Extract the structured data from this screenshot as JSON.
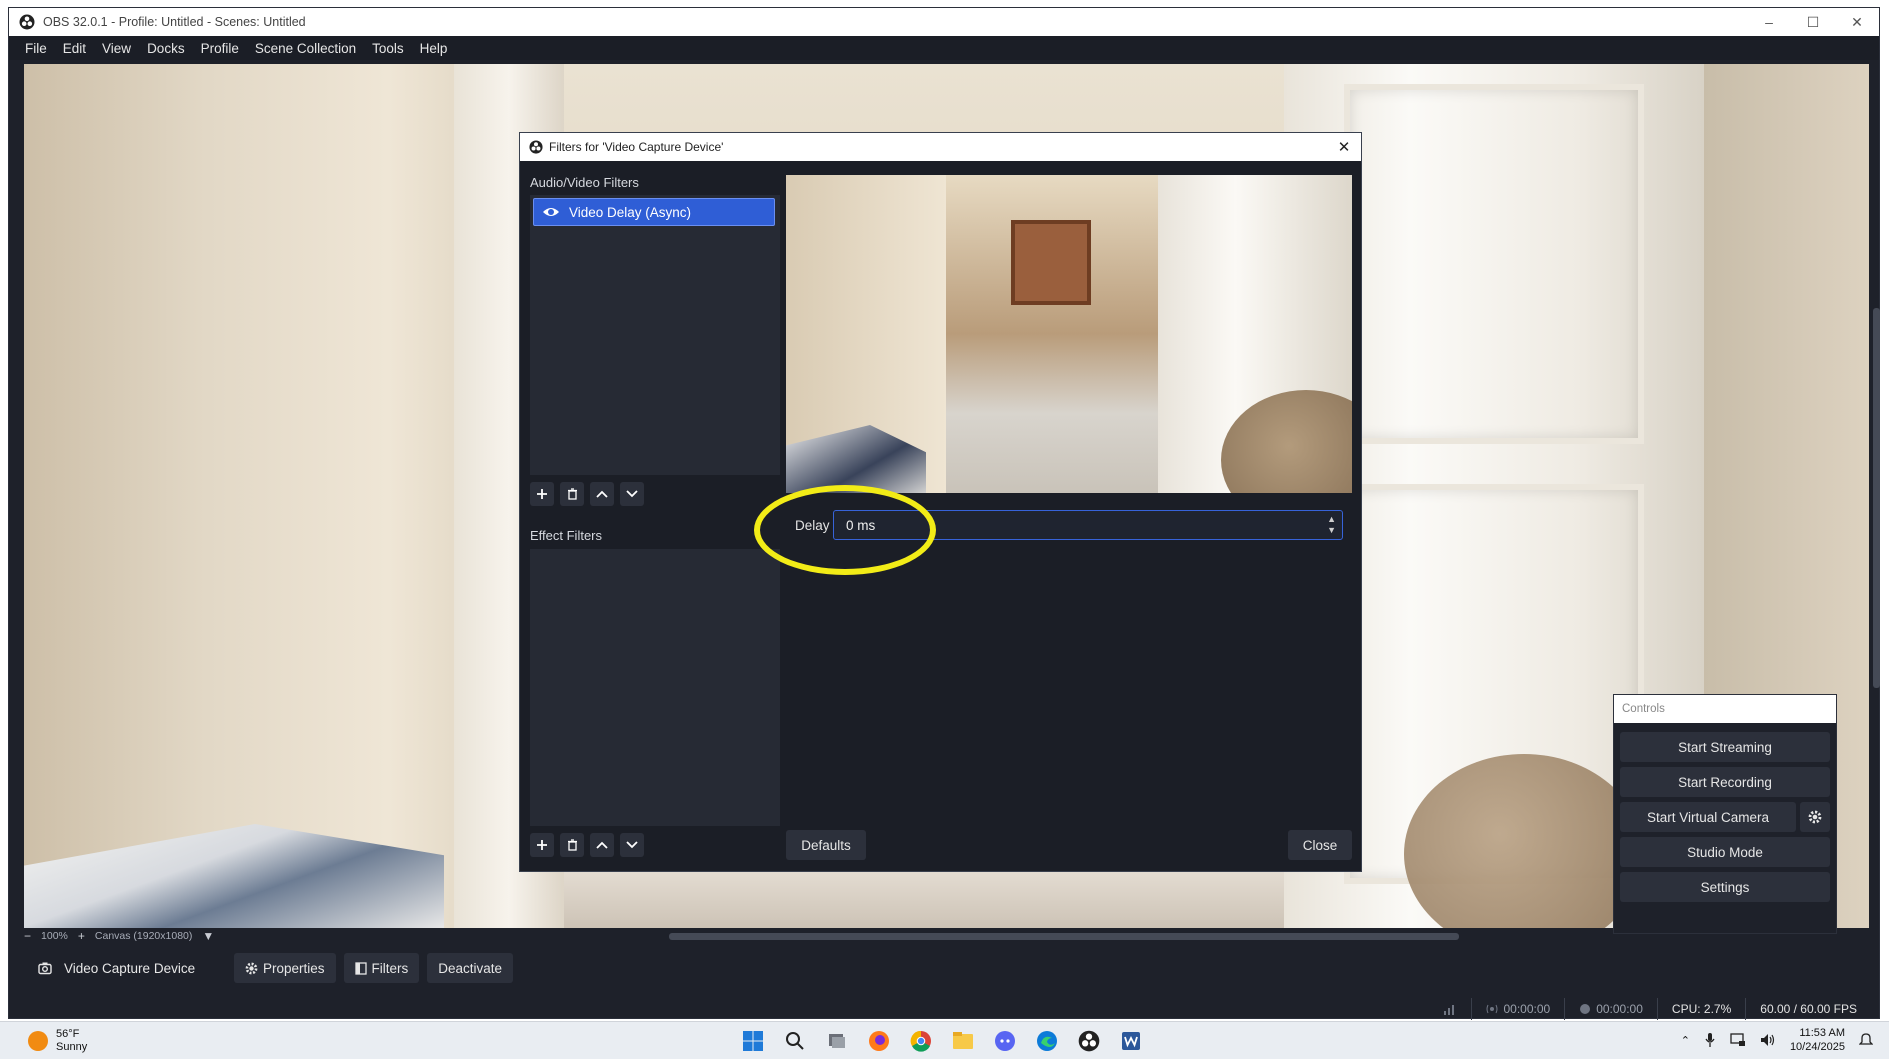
{
  "window": {
    "title": "OBS 32.0.1 - Profile: Untitled - Scenes: Untitled",
    "controls": [
      "–",
      "☐",
      "✕"
    ]
  },
  "menu": [
    "File",
    "Edit",
    "View",
    "Docks",
    "Profile",
    "Scene Collection",
    "Tools",
    "Help"
  ],
  "zoom": {
    "minus": "−",
    "level": "100%",
    "plus": "+",
    "canvas": "Canvas (1920x1080)",
    "caret": "▼"
  },
  "source_toolbar": {
    "source_name": "Video Capture Device",
    "properties": "Properties",
    "filters": "Filters",
    "deactivate": "Deactivate"
  },
  "status": {
    "stream_time": "00:00:00",
    "rec_time": "00:00:00",
    "cpu": "CPU: 2.7%",
    "fps": "60.00 / 60.00 FPS"
  },
  "controls": {
    "title": "Controls",
    "start_streaming": "Start Streaming",
    "start_recording": "Start Recording",
    "start_virtual_camera": "Start Virtual Camera",
    "studio_mode": "Studio Mode",
    "settings": "Settings"
  },
  "filters_dialog": {
    "title": "Filters for 'Video Capture Device'",
    "close_x": "✕",
    "av_filters_label": "Audio/Video Filters",
    "av_filters": [
      "Video Delay (Async)"
    ],
    "effect_filters_label": "Effect Filters",
    "delay_label": "Delay",
    "delay_value": "0 ms",
    "defaults": "Defaults",
    "close": "Close"
  },
  "taskbar": {
    "temperature": "56°F",
    "condition": "Sunny",
    "time": "11:53 AM",
    "date": "10/24/2025"
  },
  "colors": {
    "accent": "#2f5ed6",
    "highlight_ring": "#f2ec17",
    "obs_bg": "#1e212a"
  }
}
